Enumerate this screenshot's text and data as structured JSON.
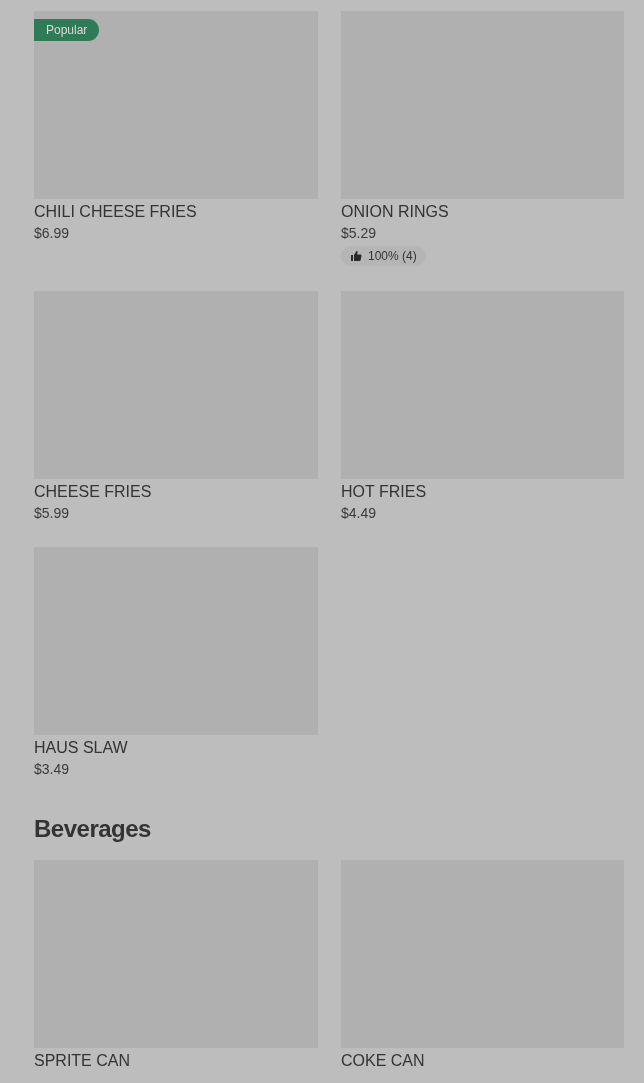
{
  "sections": [
    {
      "items": [
        {
          "name": "CHILI CHEESE FRIES",
          "price": "$6.99",
          "badge": "Popular"
        },
        {
          "name": "ONION RINGS",
          "price": "$5.29",
          "rating": "100% (4)"
        },
        {
          "name": "CHEESE FRIES",
          "price": "$5.99"
        },
        {
          "name": "HOT FRIES",
          "price": "$4.49"
        },
        {
          "name": "HAUS SLAW",
          "price": "$3.49"
        }
      ]
    },
    {
      "title": "Beverages",
      "items": [
        {
          "name": "SPRITE CAN"
        },
        {
          "name": "COKE CAN"
        }
      ]
    }
  ]
}
